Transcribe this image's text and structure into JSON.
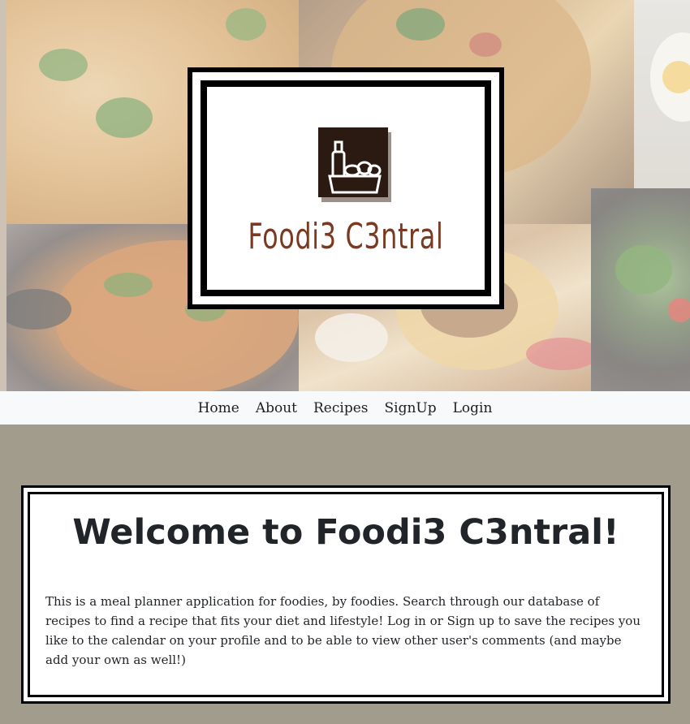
{
  "brand": {
    "logo_text": "Foodi3 C3ntral",
    "logo_icon": "grocery-bag-icon",
    "logo_text_color": "#7a3a22",
    "logo_icon_color": "#2b1a12"
  },
  "nav": {
    "items": [
      {
        "label": "Home"
      },
      {
        "label": "About"
      },
      {
        "label": "Recipes"
      },
      {
        "label": "SignUp"
      },
      {
        "label": "Login"
      }
    ]
  },
  "welcome": {
    "title": "Welcome to Foodi3 C3ntral!",
    "body": "This is a meal planner application for foodies, by foodies. Search through our database of recipes to find a recipe that fits your diet and lifestyle! Log in or Sign up to save the recipes you like to the calendar on your profile and to be able to view other user's comments (and maybe add your own as well!)"
  },
  "colors": {
    "page_background": "#a29c8d",
    "navbar_background": "#f8f9fa",
    "text": "#212529"
  }
}
